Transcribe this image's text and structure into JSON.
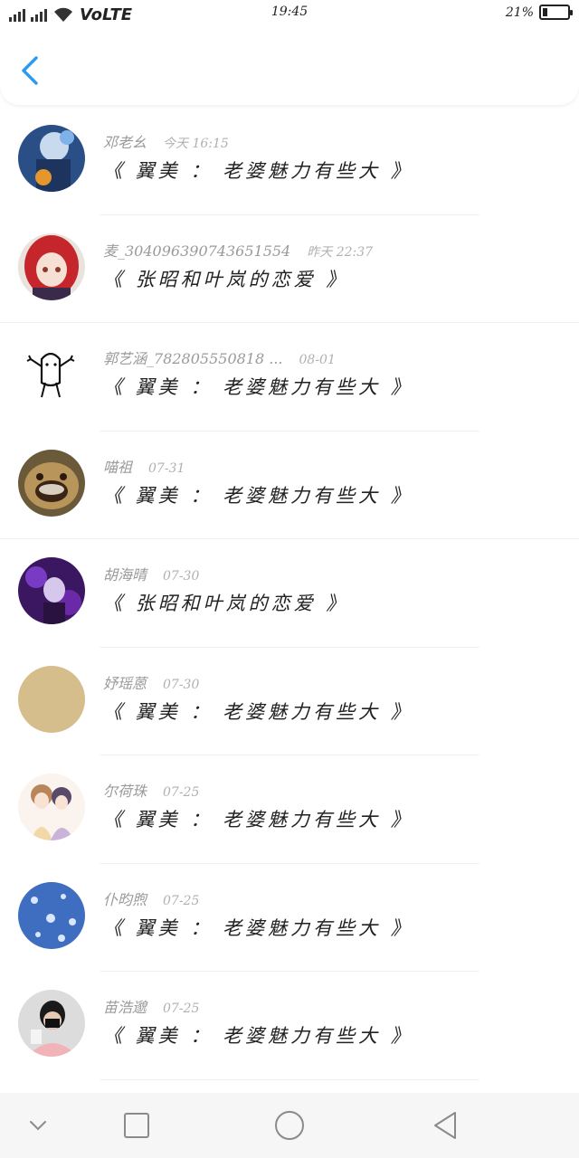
{
  "status_bar": {
    "network": "VoLTE",
    "time": "19:45",
    "battery_percent": "21%",
    "battery_level": 0.21
  },
  "header": {
    "back_icon": "chevron-left-icon",
    "accent_color": "#2b9af3"
  },
  "items": [
    {
      "name": "邓老幺",
      "time": "今天 16:15",
      "title": "《 翼美 ： 老婆魅力有些大 》"
    },
    {
      "name": "麦_304096390743651554",
      "time": "昨天 22:37",
      "title": "《 张昭和叶岚的恋爱 》"
    },
    {
      "name": "郭艺涵_782805550818 ...",
      "time": "08-01",
      "title": "《 翼美 ： 老婆魅力有些大 》"
    },
    {
      "name": "喵祖",
      "time": "07-31",
      "title": "《 翼美 ： 老婆魅力有些大 》"
    },
    {
      "name": "胡海晴",
      "time": "07-30",
      "title": "《 张昭和叶岚的恋爱 》"
    },
    {
      "name": "妤瑶蒽",
      "time": "07-30",
      "title": "《 翼美 ： 老婆魅力有些大 》"
    },
    {
      "name": "尔荷珠",
      "time": "07-25",
      "title": "《 翼美 ： 老婆魅力有些大 》"
    },
    {
      "name": "仆昀煦",
      "time": "07-25",
      "title": "《 翼美 ： 老婆魅力有些大 》"
    },
    {
      "name": "苗浩邈",
      "time": "07-25",
      "title": "《 翼美 ： 老婆魅力有些大 》"
    }
  ],
  "nav_bar": {
    "buttons": [
      "chevron-down-icon",
      "square-icon",
      "circle-icon",
      "triangle-back-icon"
    ]
  }
}
